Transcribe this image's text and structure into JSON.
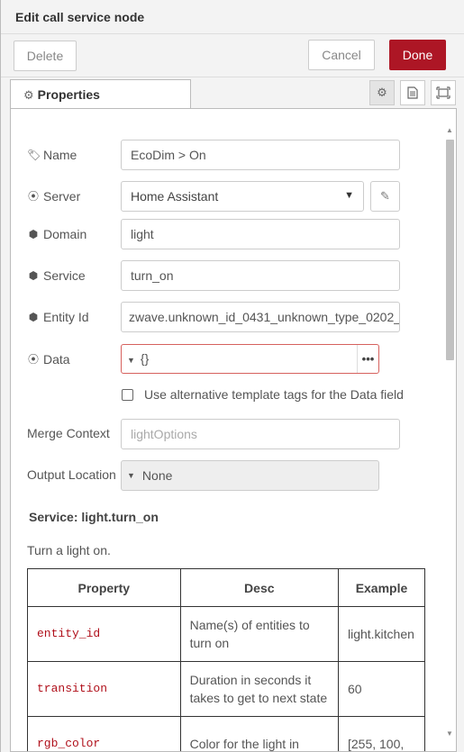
{
  "tray": {
    "title": "Edit call service node",
    "delete_label": "Delete",
    "cancel_label": "Cancel",
    "done_label": "Done",
    "done_color": "#ad1625"
  },
  "tabs": {
    "properties_label": "Properties",
    "icons": [
      "gear-icon",
      "document-icon",
      "frame-icon"
    ]
  },
  "form": {
    "name": {
      "label": "Name",
      "value": "EcoDim > On"
    },
    "server": {
      "label": "Server",
      "value": "Home Assistant"
    },
    "domain": {
      "label": "Domain",
      "value": "light"
    },
    "service": {
      "label": "Service",
      "value": "turn_on"
    },
    "entity_id": {
      "label": "Entity Id",
      "value": "zwave.unknown_id_0431_unknown_type_0202_"
    },
    "data": {
      "label": "Data",
      "type_label": "{}"
    },
    "alt_template": {
      "label": "Use alternative template tags for the Data field",
      "checked": false
    },
    "merge_context": {
      "label": "Merge Context",
      "placeholder": "lightOptions"
    },
    "output_location": {
      "label": "Output Location",
      "value": "None"
    }
  },
  "service_doc": {
    "title": "Service: light.turn_on",
    "description": "Turn a light on.",
    "columns": [
      "Property",
      "Desc",
      "Example"
    ],
    "rows": [
      {
        "property": "entity_id",
        "desc": "Name(s) of entities to turn on",
        "example": "light.kitchen"
      },
      {
        "property": "transition",
        "desc": "Duration in seconds it takes to get to next state",
        "example": "60"
      },
      {
        "property": "rgb_color",
        "desc": "Color for the light in",
        "example": "[255, 100,"
      }
    ]
  }
}
